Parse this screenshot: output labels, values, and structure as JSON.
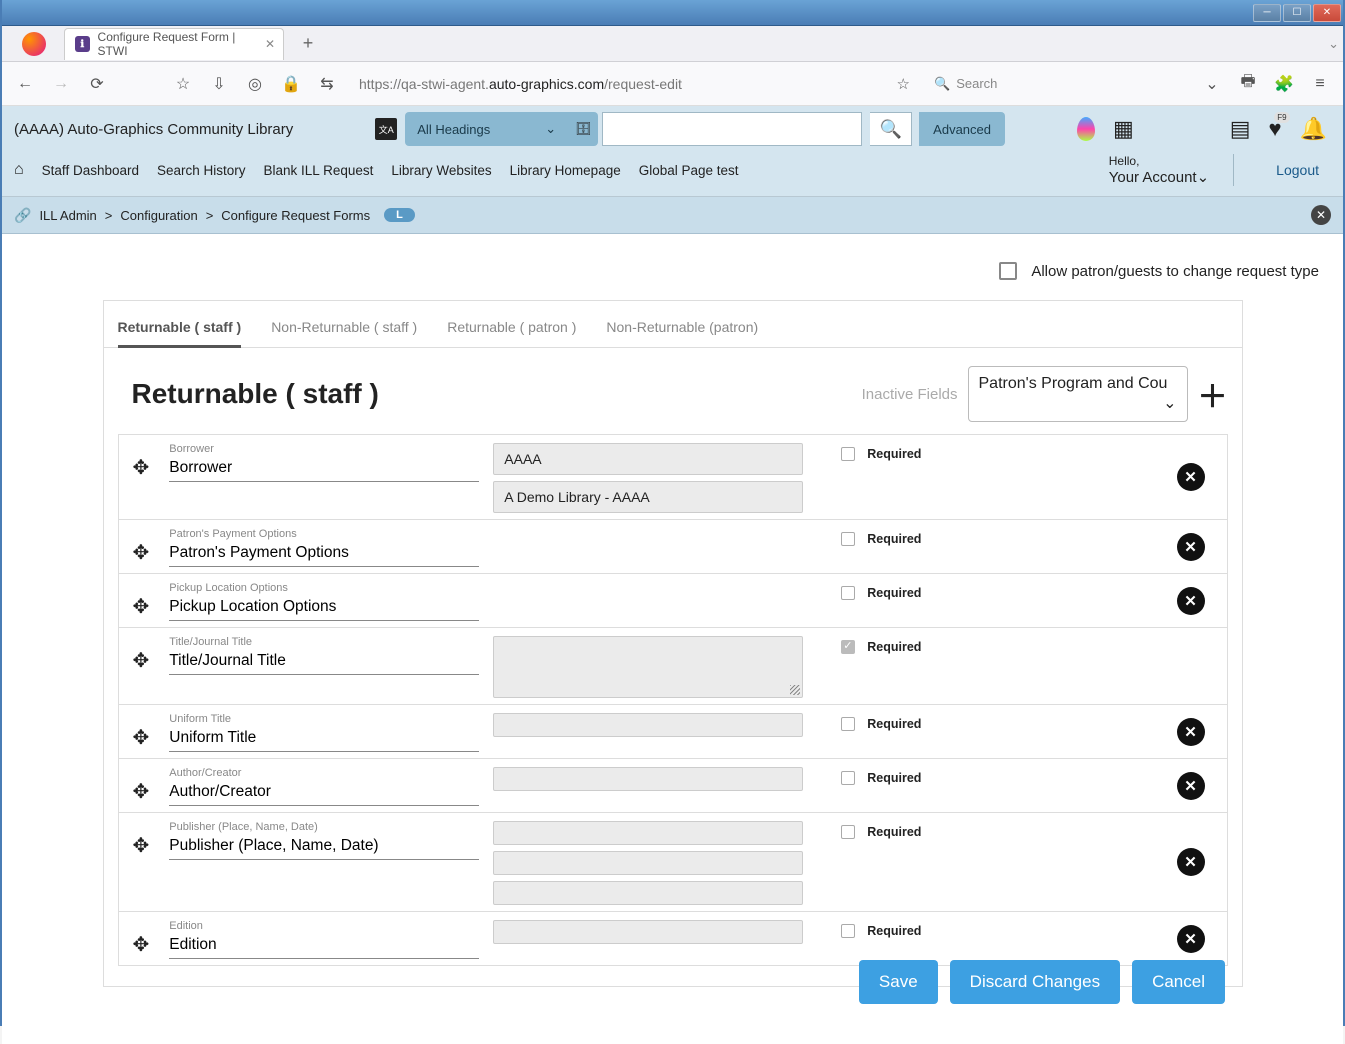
{
  "window": {
    "title_bar": ""
  },
  "browser": {
    "tab_title": "Configure Request Form | STWI",
    "url_secure_prefix": "https://qa-stwi-agent.",
    "url_host": "auto-graphics.com",
    "url_path": "/request-edit",
    "search_placeholder": "Search",
    "nav": {
      "back": "←",
      "forward": "→",
      "reload": "⟳",
      "bookmark": "☆",
      "downloads": "⬇",
      "shield": "🛡",
      "lock": "🔒",
      "adjust": "⇄",
      "star": "☆",
      "search": "🔍",
      "pocket": "⌄",
      "print": "🖶",
      "ext": "🧩",
      "menu": "≡"
    }
  },
  "app": {
    "library_name": "(AAAA) Auto-Graphics Community Library",
    "heading_dropdown": "All Headings",
    "advanced": "Advanced",
    "heart_badge": "F9",
    "nav_items": [
      "Staff Dashboard",
      "Search History",
      "Blank ILL Request",
      "Library Websites",
      "Library Homepage",
      "Global Page test"
    ],
    "hello": "Hello,",
    "your_account": "Your Account",
    "logout": "Logout"
  },
  "breadcrumb": {
    "item0": "ILL Admin",
    "item1": "Configuration",
    "item2": "Configure Request Forms",
    "badge": "L",
    "sep": ">"
  },
  "top_option": "Allow patron/guests to change request type",
  "tabs": [
    "Returnable ( staff )",
    "Non-Returnable ( staff )",
    "Returnable ( patron )",
    "Non-Returnable (patron)"
  ],
  "section": {
    "title": "Returnable ( staff )",
    "inactive_label": "Inactive Fields",
    "inactive_selected": "Patron's Program and Cou"
  },
  "required_label": "Required",
  "fields": [
    {
      "label": "Borrower",
      "value": "Borrower",
      "required": false,
      "deletable": true,
      "mid_type": "two_text",
      "mid1": "AAAA",
      "mid2": "A Demo Library - AAAA"
    },
    {
      "label": "Patron's Payment Options",
      "value": "Patron's Payment Options",
      "required": false,
      "deletable": true,
      "mid_type": "none"
    },
    {
      "label": "Pickup Location Options",
      "value": "Pickup Location Options",
      "required": false,
      "deletable": true,
      "mid_type": "none"
    },
    {
      "label": "Title/Journal Title",
      "value": "Title/Journal Title",
      "required": true,
      "deletable": false,
      "mid_type": "textarea"
    },
    {
      "label": "Uniform Title",
      "value": "Uniform Title",
      "required": false,
      "deletable": true,
      "mid_type": "small"
    },
    {
      "label": "Author/Creator",
      "value": "Author/Creator",
      "required": false,
      "deletable": true,
      "mid_type": "small"
    },
    {
      "label": "Publisher (Place, Name, Date)",
      "value": "Publisher (Place, Name, Date)",
      "required": false,
      "deletable": true,
      "mid_type": "three_small"
    },
    {
      "label": "Edition",
      "value": "Edition",
      "required": false,
      "deletable": true,
      "mid_type": "small"
    }
  ],
  "buttons": {
    "save": "Save",
    "discard": "Discard Changes",
    "cancel": "Cancel"
  }
}
